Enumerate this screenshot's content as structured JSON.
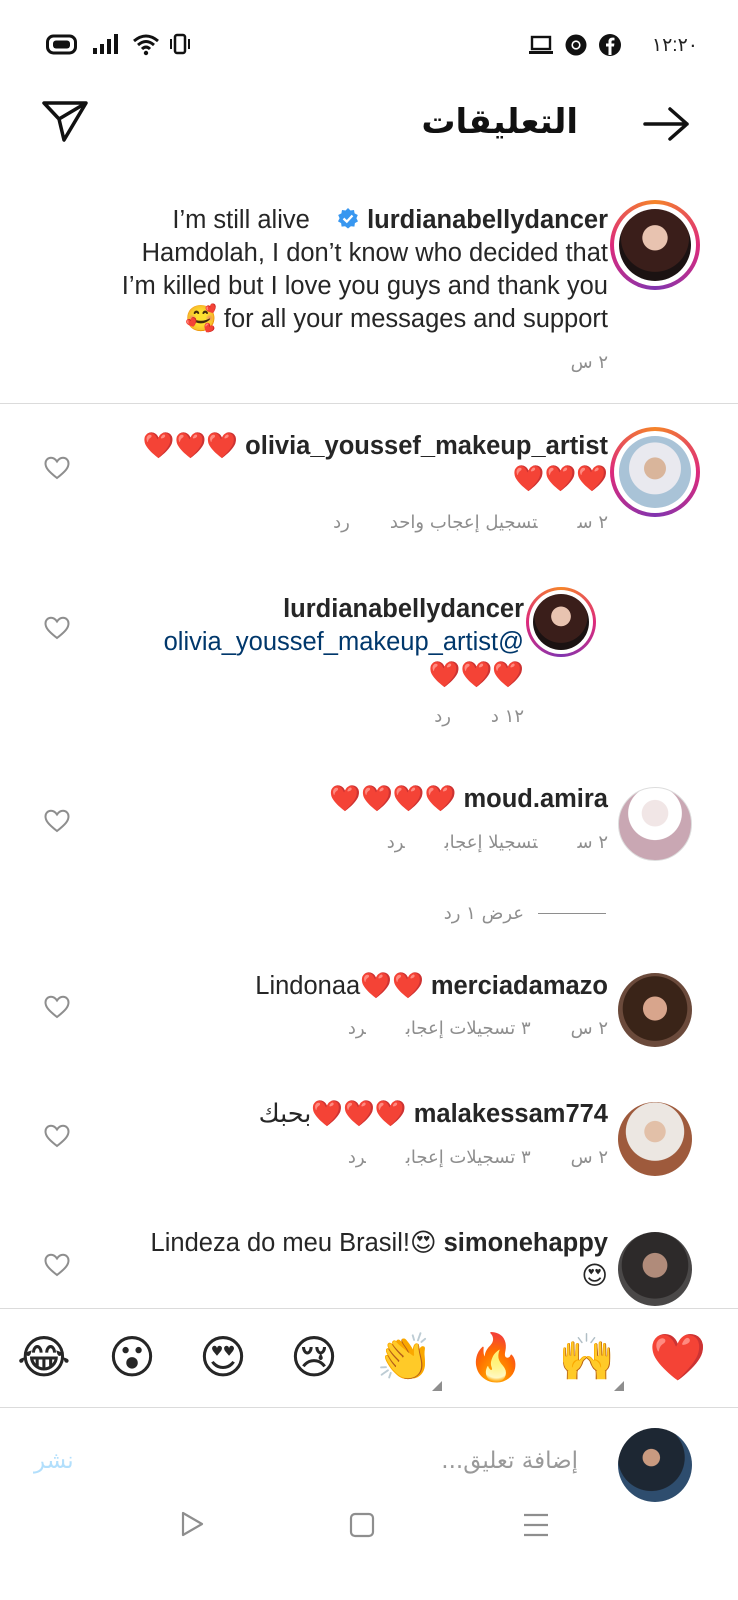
{
  "status_bar": {
    "time": "١٢:٢٠"
  },
  "header": {
    "title": "التعليقات"
  },
  "caption": {
    "username": "lurdianabellydancer",
    "text_line1": "I’m still alive",
    "text_line2": "Hamdolah, I don’t know who decided that",
    "text_line3": "I’m killed but I love you guys and thank you",
    "text_line4": "for all your messages and support",
    "emoji": "🥰",
    "time": "٢ س"
  },
  "comments": [
    {
      "username": "olivia_youssef_makeup_artist",
      "text_line1": "❤️❤️❤️",
      "text_line2": "❤️❤️❤️",
      "time": "٢ س",
      "likes": "تسجيل إعجاب واحد",
      "reply": "رد"
    },
    {
      "username": "lurdianabellydancer",
      "mention": "olivia_youssef_makeup_artist@",
      "text": "❤️❤️❤️",
      "time": "١٢ د",
      "reply": "رد"
    },
    {
      "username": "moud.amira",
      "text": "❤️❤️❤️❤️",
      "time": "٢ س",
      "likes": "تسجيلا إعجاب",
      "reply": "رد",
      "view_replies": "عرض ١ رد"
    },
    {
      "username": "merciadamazo",
      "text": "Lindonaa❤️❤️",
      "time": "٢ س",
      "likes": "٣ تسجيلات إعجاب",
      "reply": "رد"
    },
    {
      "username": "malakessam774",
      "text": "بحبك❤️❤️❤️",
      "time": "٢ س",
      "likes": "٣ تسجيلات إعجاب",
      "reply": "رد"
    },
    {
      "username": "simonehappy",
      "text": "Lindeza do meu Brasil!😍",
      "text_line2": "😍"
    }
  ],
  "emoji_bar": [
    "❤️",
    "🙌",
    "🔥",
    "👏",
    "😢",
    "😍",
    "😮",
    "😂"
  ],
  "composer": {
    "placeholder": "إضافة تعليق...",
    "post": "نشر"
  },
  "colors": {
    "verified": "#3897f0",
    "mention": "#00376b",
    "heart": "#ed1c24",
    "post_disabled": "#b2dffc"
  }
}
